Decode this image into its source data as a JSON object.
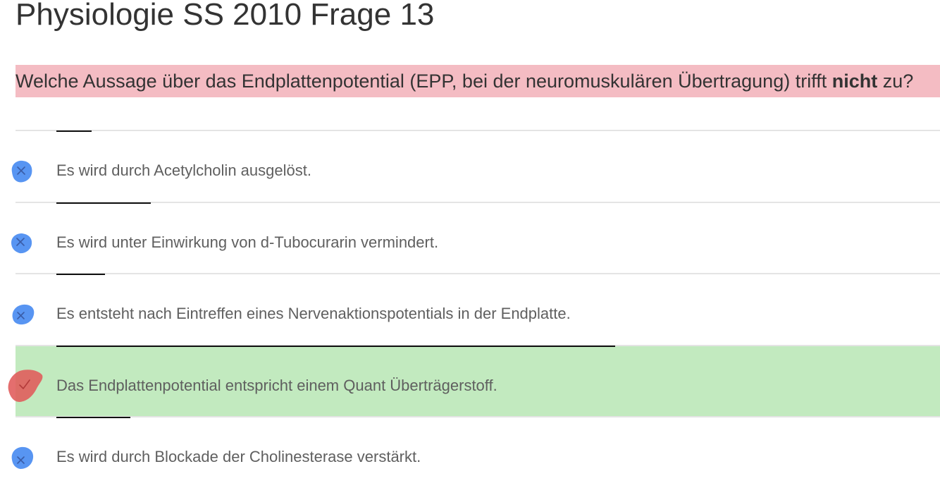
{
  "title": "Physiologie SS 2010 Frage 13",
  "question": {
    "text_before": "Welche Aussage über das Endplattenpotential (EPP, bei der neuromuskulären Übertragung) trifft ",
    "emphasis": "nicht",
    "text_after": " zu?",
    "background": "#f4bcc3"
  },
  "answers": [
    {
      "text": "Es wird durch Acetylcholin ausgelöst.",
      "mark": "x-icon",
      "mark_color": "#3b82f0",
      "selected": false
    },
    {
      "text": "Es wird unter Einwirkung von d-Tubocurarin vermindert.",
      "mark": "x-icon",
      "mark_color": "#3b82f0",
      "selected": false
    },
    {
      "text": "Es entsteht nach Eintreffen eines Nervenaktionspotentials in der Endplatte.",
      "mark": "x-icon",
      "mark_color": "#3b82f0",
      "selected": false
    },
    {
      "text": "Das Endplattenpotential entspricht einem Quant Überträgerstoff.",
      "mark": "check-icon",
      "mark_color": "#e05a5a",
      "selected": true,
      "highlight": "#c2eabf"
    },
    {
      "text": "Es wird durch Blockade der Cholinesterase verstärkt.",
      "mark": "x-icon",
      "mark_color": "#3b82f0",
      "selected": false
    }
  ]
}
